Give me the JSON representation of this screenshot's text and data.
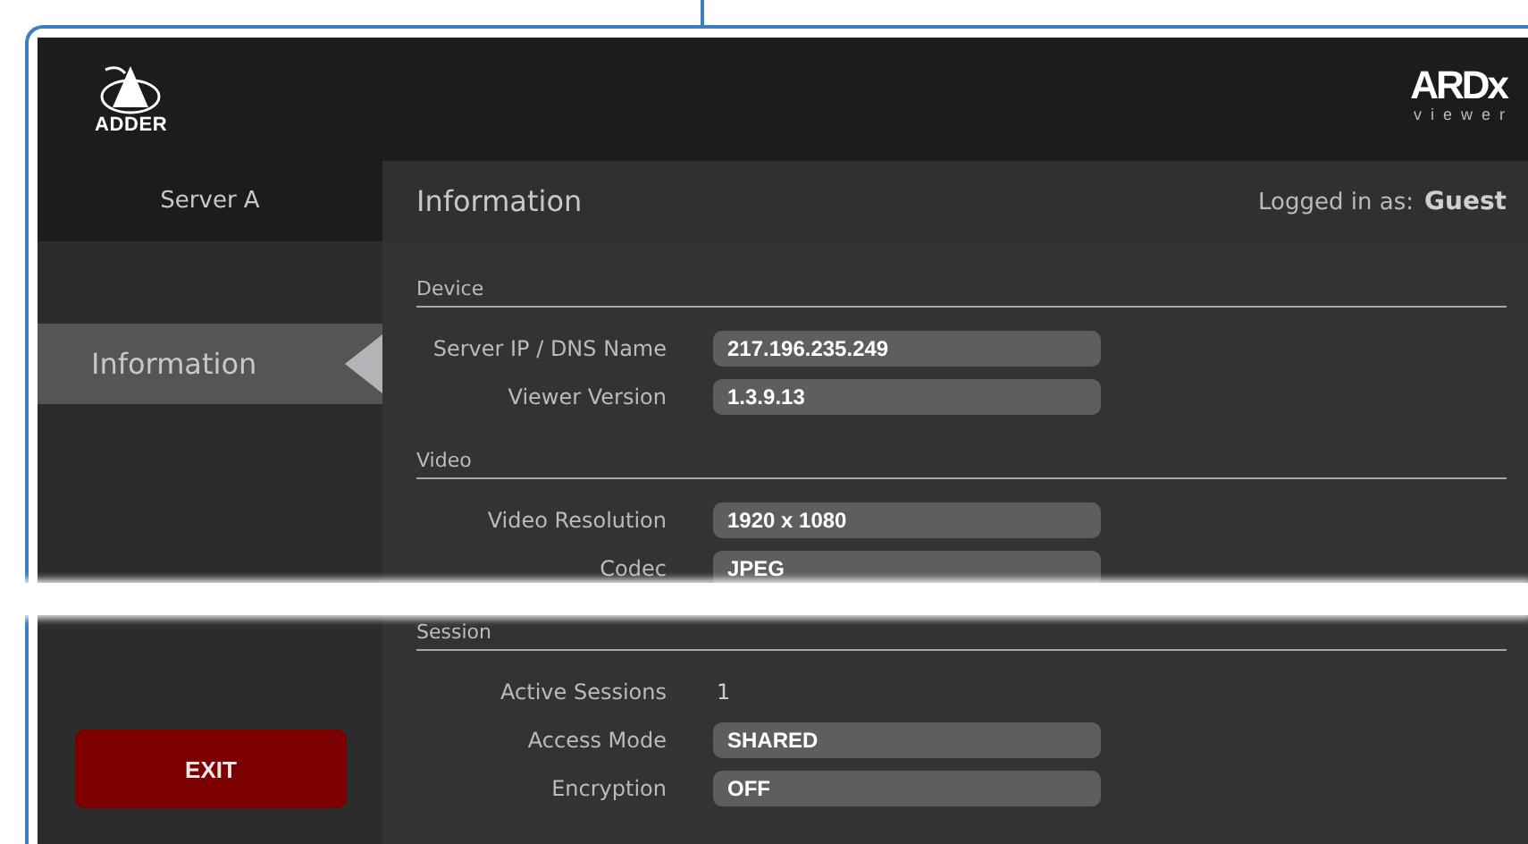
{
  "header": {
    "brand": "ADDER",
    "product": "ARDx",
    "product_sub": "viewer"
  },
  "sidebar": {
    "server": "Server A",
    "items": [
      {
        "label": "Information",
        "selected": true
      }
    ],
    "exit_button": "EXIT"
  },
  "title_bar": {
    "title": "Information",
    "logged_in_label": "Logged in as:",
    "user": "Guest"
  },
  "sections": [
    {
      "title": "Device",
      "rows": [
        {
          "label": "Server IP / DNS Name",
          "value": "217.196.235.249",
          "kind": "field"
        },
        {
          "label": "Viewer Version",
          "value": "1.3.9.13",
          "kind": "field"
        }
      ]
    },
    {
      "title": "Video",
      "rows": [
        {
          "label": "Video Resolution",
          "value": "1920 x 1080",
          "kind": "field"
        },
        {
          "label": "Codec",
          "value": "JPEG",
          "kind": "field"
        }
      ]
    },
    {
      "title": "Session",
      "rows": [
        {
          "label": "Active Sessions",
          "value": "1",
          "kind": "text"
        },
        {
          "label": "Access Mode",
          "value": "SHARED",
          "kind": "field"
        },
        {
          "label": "Encryption",
          "value": "OFF",
          "kind": "field"
        }
      ]
    }
  ]
}
